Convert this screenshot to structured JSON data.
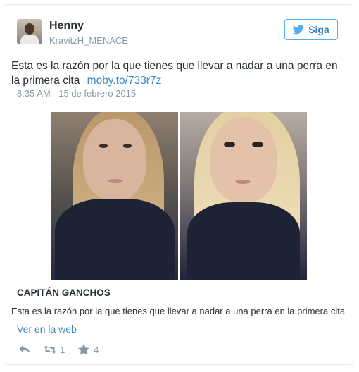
{
  "tweet": {
    "author_name": "Henny",
    "author_handle": "KravitzH_MENACE",
    "follow_label": "Siga",
    "text": "Esta es la razón por la que tienes que llevar a nadar a una perra en la primera cita",
    "link_text": "moby.to/733r7z",
    "timestamp": "8:35 AM - 15 de febrero 2015"
  },
  "card": {
    "title": "CAPITÁN GANCHOS",
    "description": "Esta es la razón por la que tienes que llevar a nadar a una perra en la primera cita",
    "link_label": "Ver en la web"
  },
  "actions": {
    "retweet_count": "1",
    "like_count": "4"
  },
  "icons": {
    "follow": "twitter-bird-icon",
    "reply": "reply-icon",
    "retweet": "retweet-icon",
    "like": "star-icon"
  },
  "colors": {
    "accent": "#55acee",
    "link": "#3b88c3",
    "muted": "#8899a6"
  }
}
